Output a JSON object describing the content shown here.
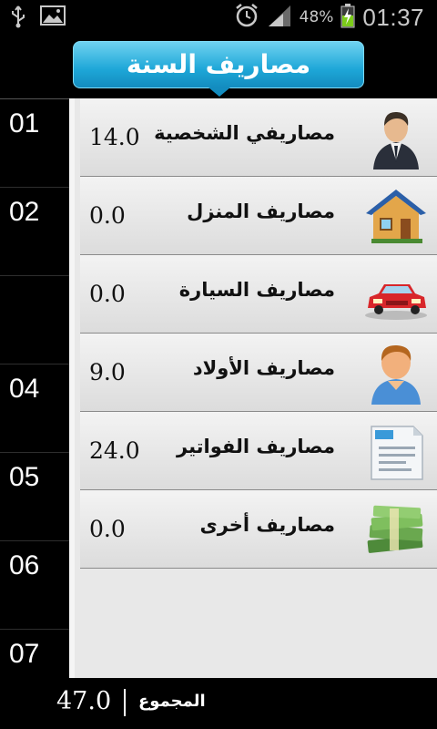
{
  "status_bar": {
    "battery_percent": "48%",
    "time": "01:37",
    "icons": [
      "usb-icon",
      "image-icon",
      "alarm-icon",
      "signal-icon",
      "battery-charging-icon"
    ]
  },
  "header": {
    "title": "مصاريف السنة"
  },
  "months": [
    "01",
    "02",
    "",
    "04",
    "05",
    "06",
    "07"
  ],
  "rows": [
    {
      "label": "مصاريفي الشخصية",
      "value": "14.0",
      "icon": "businessman-icon"
    },
    {
      "label": "مصاريف المنزل",
      "value": "0.0",
      "icon": "house-icon"
    },
    {
      "label": "مصاريف السيارة",
      "value": "0.0",
      "icon": "car-icon"
    },
    {
      "label": "مصاريف الأولاد",
      "value": "9.0",
      "icon": "child-icon"
    },
    {
      "label": "مصاريف الفواتير",
      "value": "24.0",
      "icon": "bill-icon"
    },
    {
      "label": "مصاريف أخرى",
      "value": "0.0",
      "icon": "money-stack-icon"
    }
  ],
  "footer": {
    "total": "47.0",
    "label": "المجموع"
  }
}
